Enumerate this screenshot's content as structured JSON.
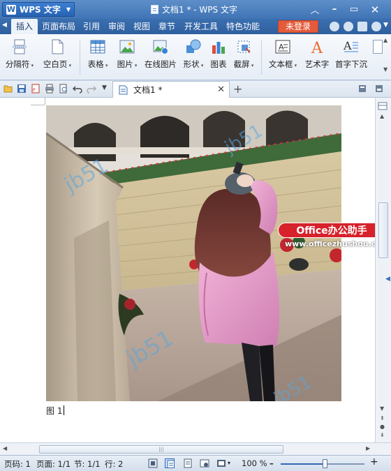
{
  "titlebar": {
    "app_label": "WPS 文字",
    "document_title": "文档1 * - WPS 文字"
  },
  "menubar": {
    "items": [
      {
        "label": "插入",
        "active": true
      },
      {
        "label": "页面布局"
      },
      {
        "label": "引用"
      },
      {
        "label": "审阅"
      },
      {
        "label": "视图"
      },
      {
        "label": "章节"
      },
      {
        "label": "开发工具"
      },
      {
        "label": "特色功能"
      }
    ],
    "login_label": "未登录"
  },
  "ribbon": {
    "items": [
      {
        "label": "分隔符",
        "icon": "page-break-icon"
      },
      {
        "label": "空白页",
        "icon": "blank-page-icon"
      },
      {
        "label": "表格",
        "icon": "table-icon"
      },
      {
        "label": "图片",
        "icon": "picture-icon"
      },
      {
        "label": "在线图片",
        "icon": "online-picture-icon"
      },
      {
        "label": "形状",
        "icon": "shapes-icon"
      },
      {
        "label": "图表",
        "icon": "chart-icon"
      },
      {
        "label": "截屏",
        "icon": "screenshot-icon"
      },
      {
        "label": "文本框",
        "icon": "textbox-icon"
      },
      {
        "label": "艺术字",
        "icon": "wordart-icon"
      },
      {
        "label": "首字下沉",
        "icon": "dropcap-icon"
      }
    ]
  },
  "tabs": {
    "doc_tab_label": "文档1 *"
  },
  "document": {
    "caption_text": "图 1",
    "watermark_brand": "Office办公助手",
    "watermark_url": "www.officezhushou.com",
    "watermark_logo_text": "jb51"
  },
  "statusbar": {
    "page_code": "页码: 1",
    "page_count": "页面: 1/1",
    "section": "节: 1/1",
    "line": "行: 2",
    "zoom": "100 %",
    "zoom_slider_fraction": 0.53
  },
  "colors": {
    "title_blue": "#3f74b5",
    "login_red": "#e35b3a",
    "watermark_red": "#d7212b"
  }
}
